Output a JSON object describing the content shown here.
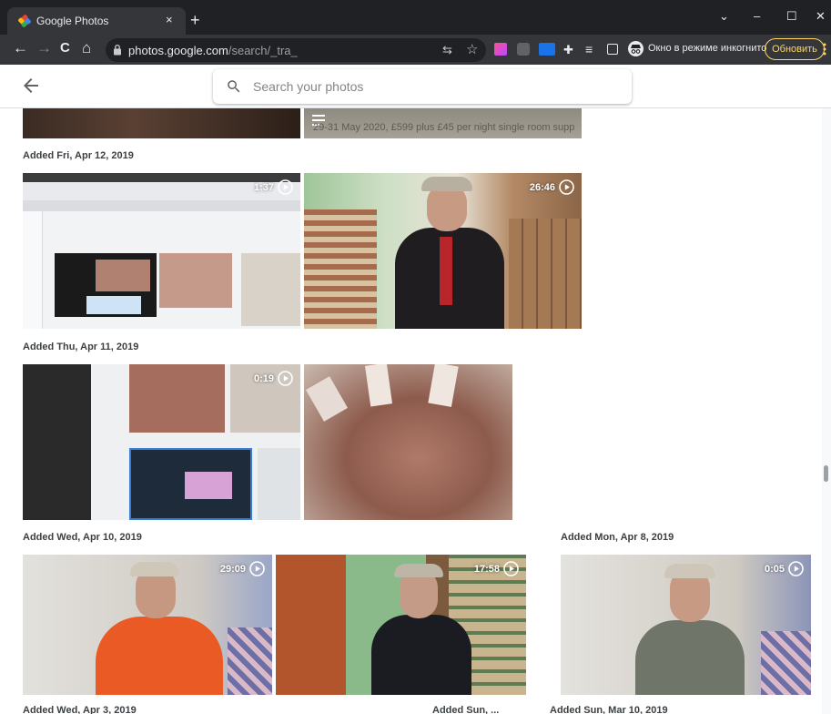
{
  "browser": {
    "tab_title": "Google Photos",
    "tab_close": "×",
    "new_tab": "+",
    "window_minimize": "–",
    "window_maximize": "☐",
    "window_close": "✕",
    "window_chevron": "⌄",
    "back": "←",
    "forward": "→",
    "reload": "C",
    "home": "⌂",
    "url_host": "photos.google.com",
    "url_path": "/search/_tra_",
    "translate_icon": "⇆",
    "star_icon": "☆",
    "extensions_icon": "✚",
    "reading_list_icon": "≡",
    "incognito_label": "Окно в режиме инкогнито",
    "update_label": "Обновить"
  },
  "app": {
    "search_placeholder": "Search your photos",
    "top_partial_caption": "29-31 May 2020, £599 plus £45 per night single room supp"
  },
  "groups": [
    {
      "label": "Added Fri, Apr 12, 2019",
      "items": [
        {
          "type": "video",
          "duration": "1:37",
          "subject": "screen-recording"
        },
        {
          "type": "video",
          "duration": "26:46",
          "subject": "man-in-library"
        }
      ]
    },
    {
      "label": "Added Thu, Apr 11, 2019",
      "items": [
        {
          "type": "video",
          "duration": "0:19",
          "subject": "screen-recording"
        },
        {
          "type": "photo",
          "subject": "blurred-hand"
        }
      ]
    },
    {
      "label": "Added Wed, Apr 10, 2019",
      "items": [
        {
          "type": "video",
          "duration": "29:09",
          "subject": "man-orange-shirt"
        },
        {
          "type": "video",
          "duration": "17:58",
          "subject": "man-in-library"
        }
      ]
    },
    {
      "label": "Added Mon, Apr 8, 2019",
      "items": [
        {
          "type": "video",
          "duration": "0:05",
          "subject": "man-grey-tshirt"
        }
      ]
    }
  ],
  "bottom_labels": [
    "Added Wed, Apr 3, 2019",
    "Added Sun, ...",
    "Added Sun, Mar 10, 2019"
  ],
  "colors": {
    "chrome_dark": "#202124",
    "chrome_toolbar": "#35363a",
    "update_accent": "#fdd663",
    "label_text": "#3c4043"
  }
}
